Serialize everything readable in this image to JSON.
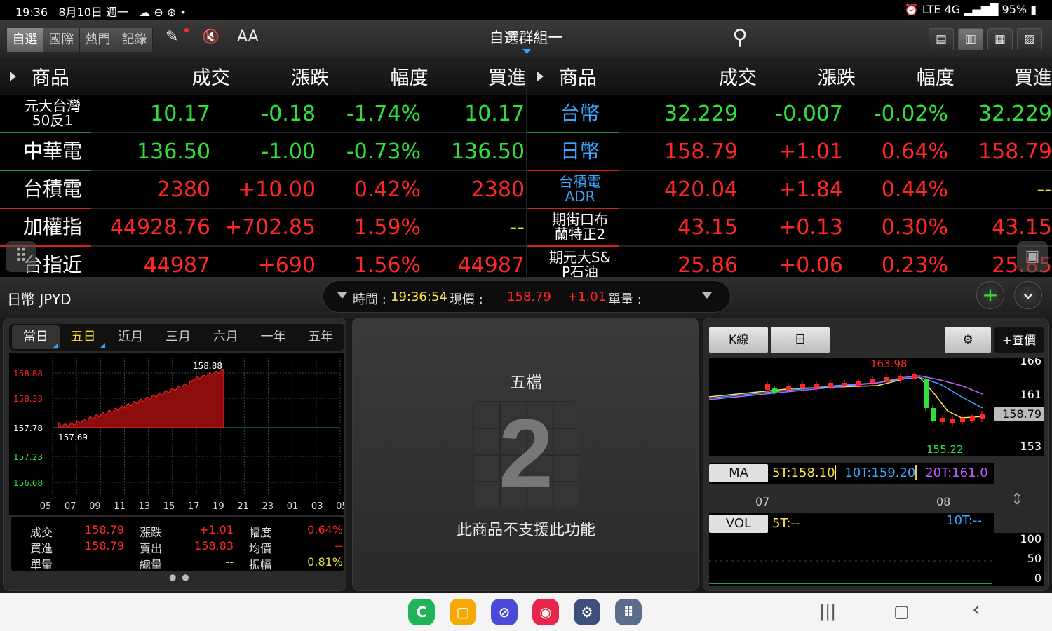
{
  "status": {
    "time": "19:36",
    "date": "8月10日 週一",
    "left_icons": "☁ ⊖ ⊛ •",
    "right_icons": "⏰ LTE 4G ▂▄▆█",
    "battery": "95%"
  },
  "toolbar": {
    "tabs": [
      "自選",
      "國際",
      "熱門",
      "記錄"
    ],
    "group_title": "自選群組一",
    "font_label": "AA",
    "edit_icon": "✎",
    "mute_icon": "🔇",
    "search_icon": "⚲",
    "views": [
      "▤",
      "▥",
      "▦",
      "▨"
    ]
  },
  "quote_left": {
    "headers": [
      "商品",
      "成交",
      "漲跌",
      "幅度",
      "買進"
    ],
    "rows": [
      {
        "name": "元大台灣\n50反1",
        "last": "10.17",
        "chg": "-0.18",
        "pct": "-1.74%",
        "bid": "10.17",
        "dir": "down",
        "small": true
      },
      {
        "name": "中華電",
        "last": "136.50",
        "chg": "-1.00",
        "pct": "-0.73%",
        "bid": "136.50",
        "dir": "down",
        "small": false
      },
      {
        "name": "台積電",
        "last": "2380",
        "chg": "+10.00",
        "pct": "0.42%",
        "bid": "2380",
        "dir": "up",
        "small": false
      },
      {
        "name": "加權指",
        "last": "44928.76",
        "chg": "+702.85",
        "pct": "1.59%",
        "bid": "--",
        "dir": "up",
        "small": false
      },
      {
        "name": "台指近",
        "last": "44987",
        "chg": "+690",
        "pct": "1.56%",
        "bid": "44987",
        "dir": "up",
        "small": false
      }
    ]
  },
  "quote_right": {
    "headers": [
      "商品",
      "成交",
      "漲跌",
      "幅度",
      "買進"
    ],
    "rows": [
      {
        "name": "台幣",
        "last": "32.229",
        "chg": "-0.007",
        "pct": "-0.02%",
        "bid": "32.229",
        "dir": "down",
        "blue": true,
        "small": false
      },
      {
        "name": "日幣",
        "last": "158.79",
        "chg": "+1.01",
        "pct": "0.64%",
        "bid": "158.79",
        "dir": "up",
        "blue": true,
        "small": false
      },
      {
        "name": "台積電\nADR",
        "last": "420.04",
        "chg": "+1.84",
        "pct": "0.44%",
        "bid": "--",
        "dir": "up",
        "blue": true,
        "small": true
      },
      {
        "name": "期街口布\n蘭特正2",
        "last": "43.15",
        "chg": "+0.13",
        "pct": "0.30%",
        "bid": "43.15",
        "dir": "up",
        "blue": false,
        "small": true
      },
      {
        "name": "期元大S&\nP石油",
        "last": "25.86",
        "chg": "+0.06",
        "pct": "0.23%",
        "bid": "25.85",
        "dir": "up",
        "blue": false,
        "small": true
      }
    ]
  },
  "info": {
    "symbol": "日幣 JPYD",
    "time_label": "時間 :",
    "time": "19:36:54",
    "price_label": "現價 :",
    "price": "158.79",
    "change": "+1.01",
    "qty_label": "單量 :",
    "add_icon": "+",
    "collapse_icon": "⌄"
  },
  "intraday": {
    "tabs": [
      "當日",
      "五日",
      "近月",
      "三月",
      "六月",
      "一年",
      "五年"
    ],
    "y_ticks": [
      "158.88",
      "158.33",
      "157.78",
      "157.23",
      "156.68"
    ],
    "x_ticks": [
      "05",
      "07",
      "09",
      "11",
      "13",
      "15",
      "17",
      "19",
      "21",
      "23",
      "01",
      "03",
      "05"
    ],
    "high_label": "158.88",
    "low_label": "157.69",
    "colors": {
      "up": "#ff2626",
      "down": "#2fe03c",
      "ref": "#ffffff"
    },
    "stats": [
      {
        "label": "成交",
        "value": "158.79",
        "color": "up"
      },
      {
        "label": "漲跌",
        "value": "+1.01",
        "color": "up"
      },
      {
        "label": "幅度",
        "value": "0.64%",
        "color": "up"
      },
      {
        "label": "買進",
        "value": "158.79",
        "color": "up"
      },
      {
        "label": "賣出",
        "value": "158.83",
        "color": "up"
      },
      {
        "label": "均價",
        "value": "--",
        "color": "up"
      },
      {
        "label": "單量",
        "value": "",
        "color": "up"
      },
      {
        "label": "總量",
        "value": "--",
        "color": "flat"
      },
      {
        "label": "振幅",
        "value": "0.81%",
        "color": "flat"
      }
    ]
  },
  "five_level": {
    "title": "五檔",
    "badge_number": "2",
    "message": "此商品不支援此功能"
  },
  "kline": {
    "buttons": [
      "K線",
      "日"
    ],
    "settings_icon": "⚙",
    "quote_button": "+查價",
    "y_ticks": [
      "166",
      "161",
      "153"
    ],
    "current": "158.79",
    "high": "163.98",
    "low": "155.22",
    "ma_label": "MA",
    "ma5": "5T:158.10",
    "ma10": "10T:159.20",
    "ma20": "20T:161.0",
    "dates": [
      "07",
      "08"
    ],
    "vol_label": "VOL",
    "vol5": "5T:--",
    "vol10": "10T:--",
    "vol_ticks": [
      "100",
      "50",
      "0"
    ],
    "sort_icon": "⇕"
  },
  "navbar": {
    "apps": [
      "C",
      "▢",
      "⊘",
      "◉",
      "⚙",
      "⠿"
    ],
    "app_colors": [
      "#1fb35a",
      "#f6a800",
      "#4a4ad6",
      "#e8254a",
      "#3d4f7a",
      "#5c6c8c"
    ],
    "recent": "|||",
    "home": "▢",
    "back": "‹"
  }
}
